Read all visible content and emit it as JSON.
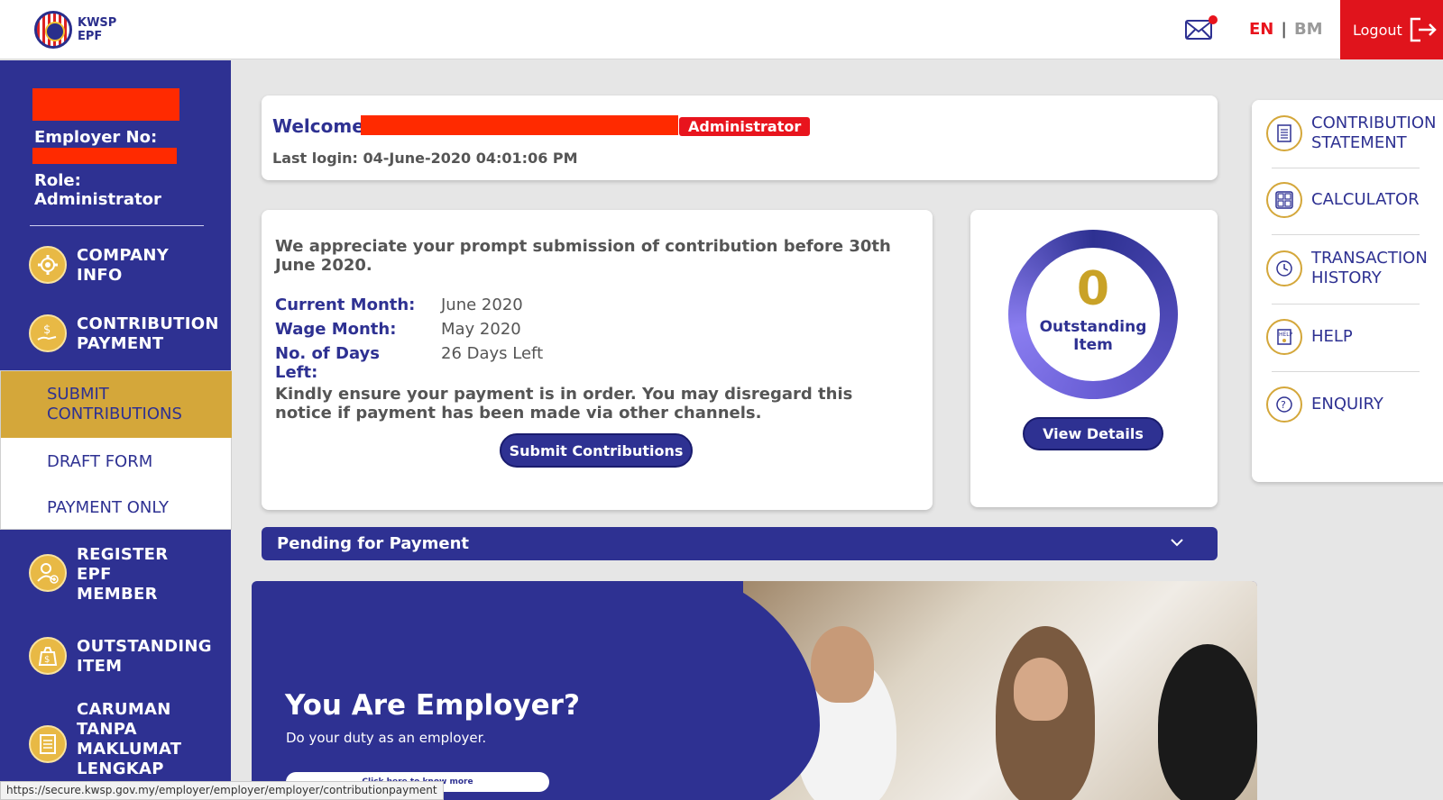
{
  "header": {
    "logo_line1": "KWSP",
    "logo_line2": "EPF",
    "lang_en": "EN",
    "lang_sep": "|",
    "lang_bm": "BM",
    "logout_label": "Logout",
    "logout_color": "#e0141c"
  },
  "sidebar": {
    "employer_label": "Employer No:",
    "role_line1": "Role:",
    "role_line2": "Administrator",
    "items": [
      {
        "line1": "COMPANY",
        "line2": "INFO",
        "icon": "gear-icon"
      },
      {
        "line1": "CONTRIBUTION",
        "line2": "PAYMENT",
        "icon": "payment-hand-icon"
      },
      {
        "line1": "REGISTER",
        "line2": "EPF",
        "line3": "MEMBER",
        "icon": "add-member-icon"
      },
      {
        "line1": "OUTSTANDING",
        "line2": "ITEM",
        "icon": "money-bag-icon"
      },
      {
        "line1": "CARUMAN",
        "line2": "TANPA",
        "line3": "MAKLUMAT",
        "line4": "LENGKAP",
        "icon": "document-icon"
      }
    ],
    "submenu": {
      "submit_line1": "SUBMIT",
      "submit_line2": "CONTRIBUTIONS",
      "draft": "DRAFT FORM",
      "payment_only": "PAYMENT ONLY"
    },
    "bg_color": "#2e3192",
    "accent_color": "#d4a73a"
  },
  "welcome": {
    "label": "Welcome",
    "role_badge": "Administrator",
    "last_login": "Last login: 04-June-2020 04:01:06 PM"
  },
  "contribution": {
    "notice": "We appreciate your prompt submission of contribution before 30th June 2020.",
    "current_month_key": "Current Month:",
    "current_month_val": "June 2020",
    "wage_month_key": "Wage Month:",
    "wage_month_val": "May 2020",
    "days_key_line1": "No. of Days",
    "days_key_line2": "Left:",
    "days_val": "26 Days Left",
    "notice2": "Kindly ensure your payment is in order. You may disregard this notice if payment has been made via other channels.",
    "submit_button": "Submit Contributions"
  },
  "outstanding": {
    "count": "0",
    "label_line1": "Outstanding",
    "label_line2": "Item",
    "view_button": "View Details"
  },
  "pending": {
    "label": "Pending for Payment"
  },
  "banner": {
    "title": "You Are Employer?",
    "subtitle": "Do your duty as an employer.",
    "button": "Click here to know more"
  },
  "right_panel": {
    "items": [
      {
        "line1": "CONTRIBUTION",
        "line2": "STATEMENT",
        "icon": "statement-icon"
      },
      {
        "line1": "CALCULATOR",
        "icon": "calculator-icon"
      },
      {
        "line1": "TRANSACTION",
        "line2": "HISTORY",
        "icon": "history-icon"
      },
      {
        "line1": "HELP",
        "icon": "help-icon"
      },
      {
        "line1": "ENQUIRY",
        "icon": "enquiry-icon"
      }
    ]
  },
  "status_bar": {
    "url": "https://secure.kwsp.gov.my/employer/employer/employer/contributionpayment"
  }
}
